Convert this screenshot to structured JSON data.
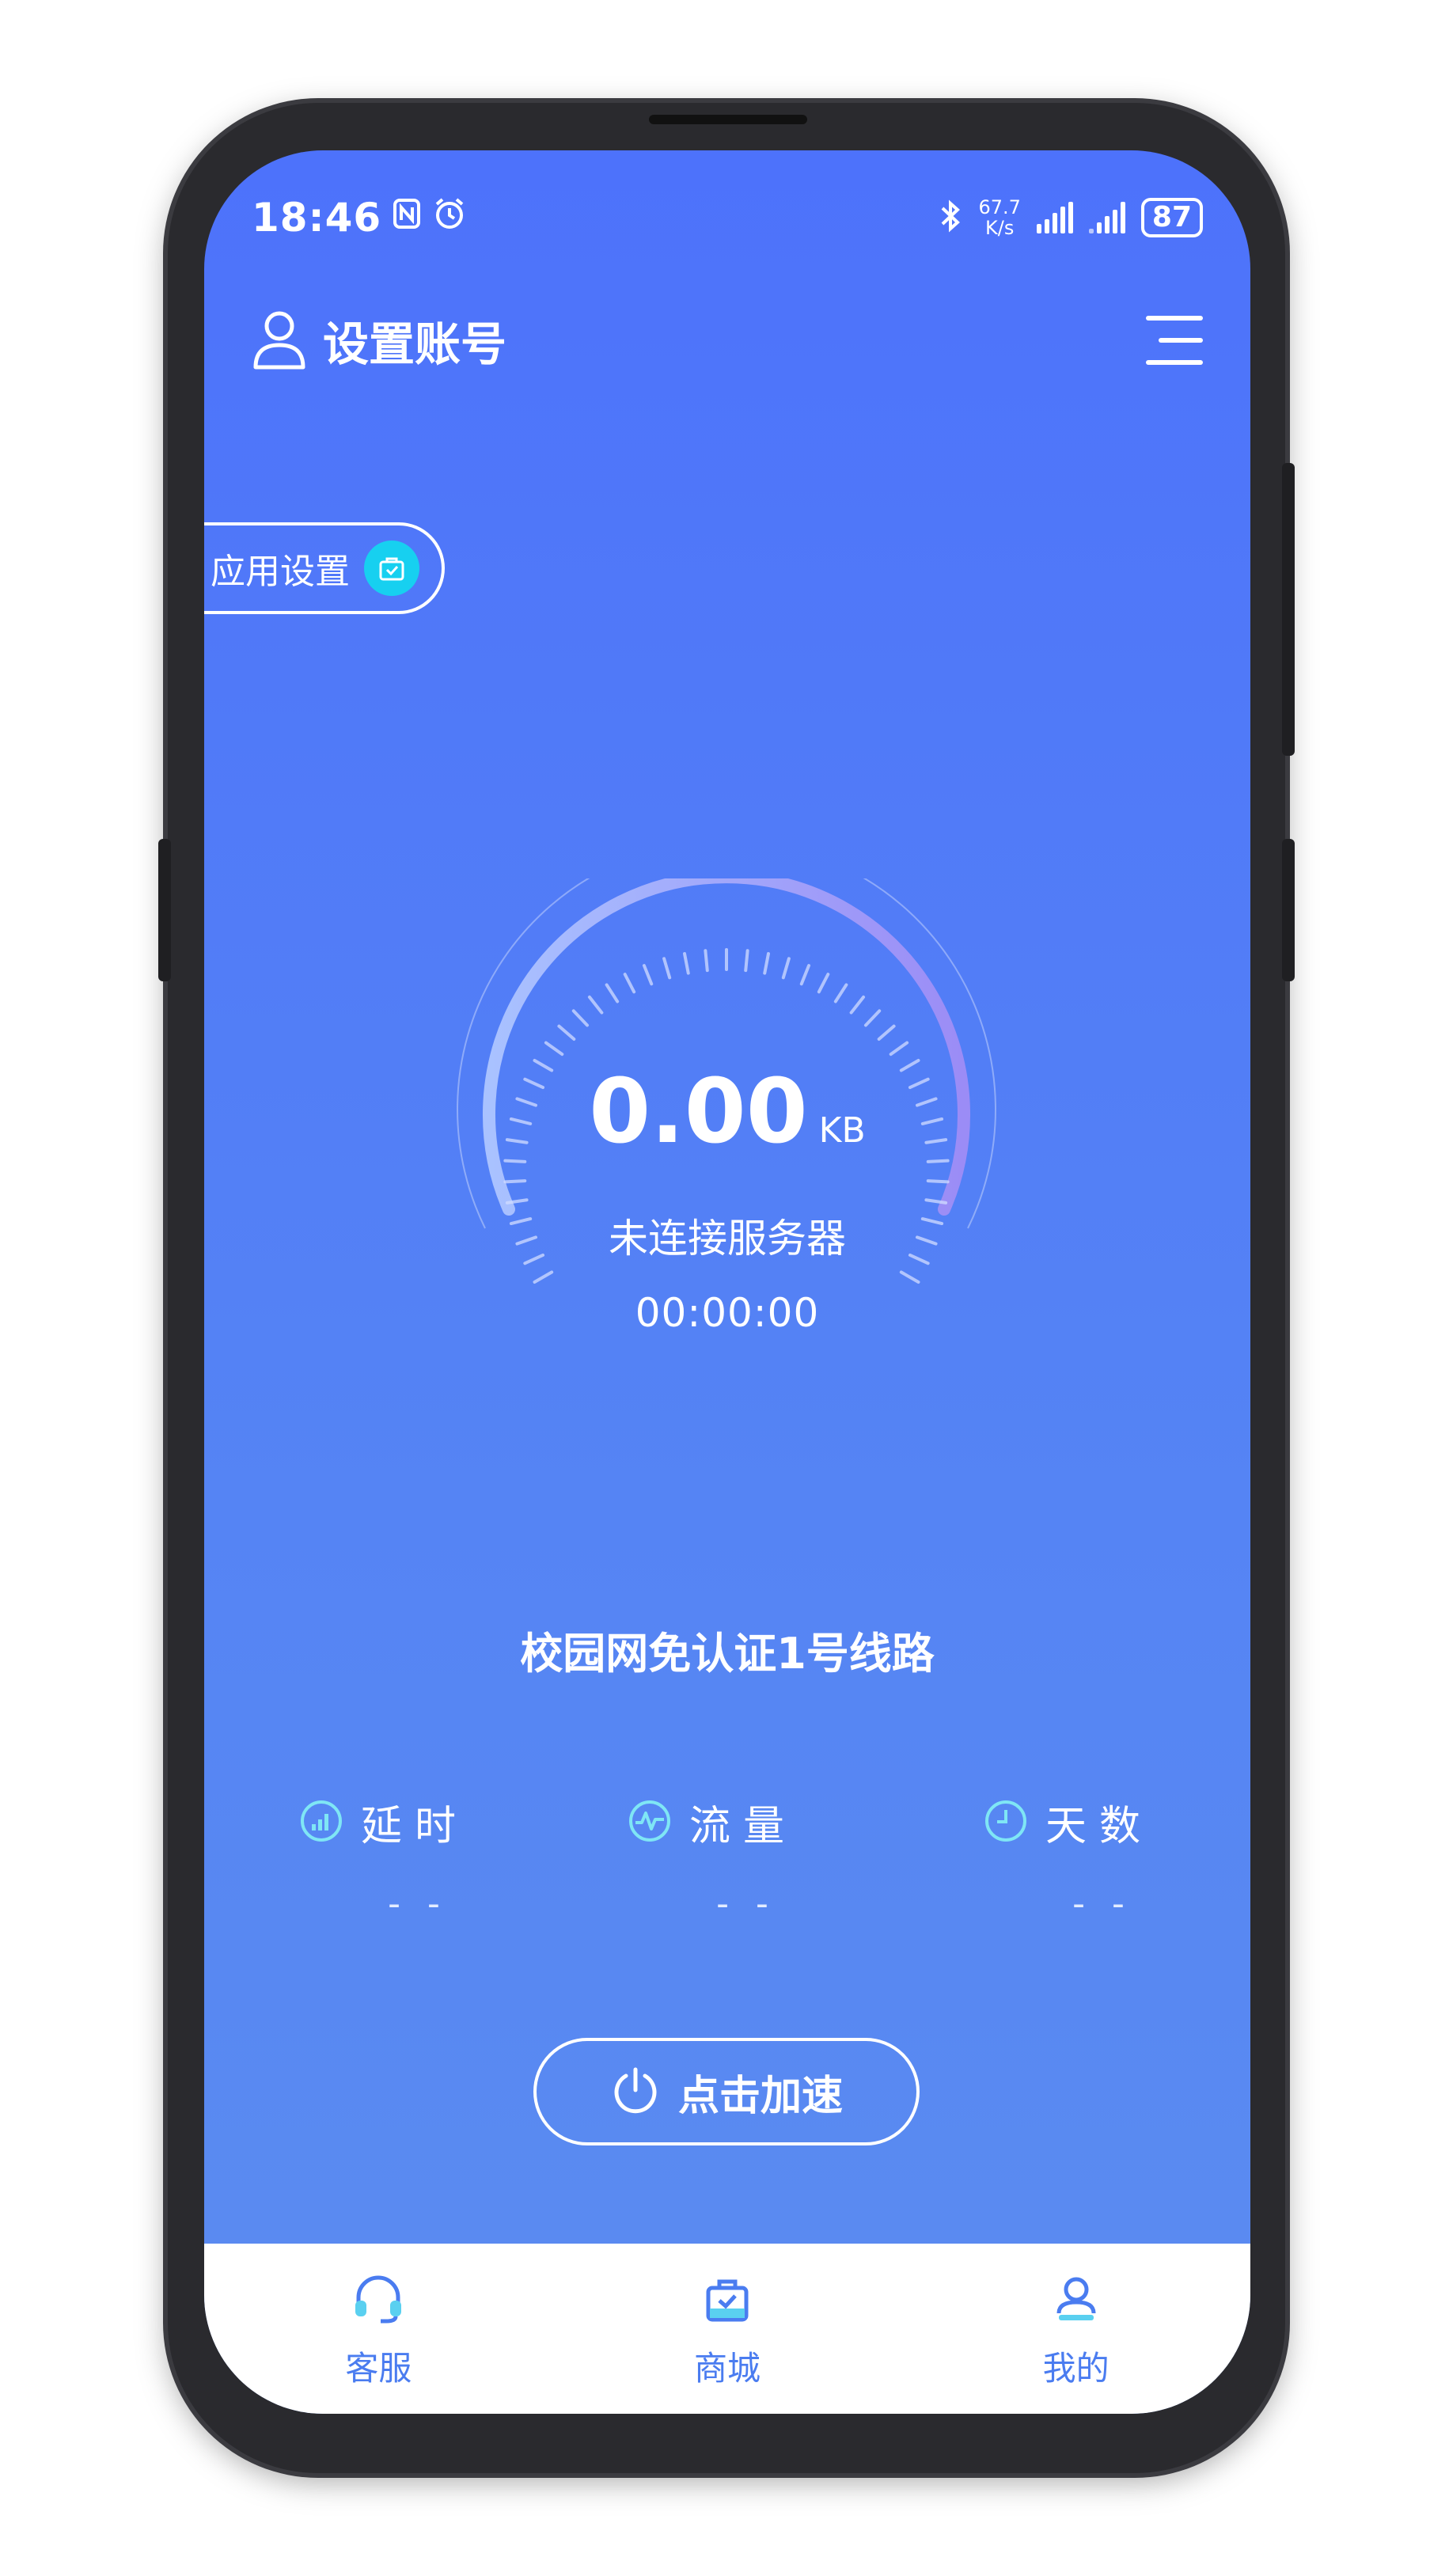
{
  "status_bar": {
    "time": "18:46",
    "net_speed_value": "67.7",
    "net_speed_unit": "K/s",
    "battery": "87"
  },
  "header": {
    "account_label": "设置账号"
  },
  "app_settings": {
    "label": "应用设置"
  },
  "gauge": {
    "value": "0.00",
    "unit": "KB",
    "status": "未连接服务器",
    "timer": "00:00:00"
  },
  "route": {
    "name": "校园网免认证1号线路"
  },
  "stats": [
    {
      "label": "延时",
      "value": "- -",
      "icon": "signal-icon"
    },
    {
      "label": "流量",
      "value": "- -",
      "icon": "pulse-icon"
    },
    {
      "label": "天数",
      "value": "- -",
      "icon": "clock-icon"
    }
  ],
  "accelerate": {
    "label": "点击加速"
  },
  "nav": [
    {
      "label": "客服",
      "icon": "headset-icon"
    },
    {
      "label": "商城",
      "icon": "shopping-bag-icon"
    },
    {
      "label": "我的",
      "icon": "profile-icon"
    }
  ],
  "colors": {
    "primary_blue": "#4d72fb",
    "accent_cyan": "#17d0f0",
    "nav_text": "#4a7cf0"
  }
}
